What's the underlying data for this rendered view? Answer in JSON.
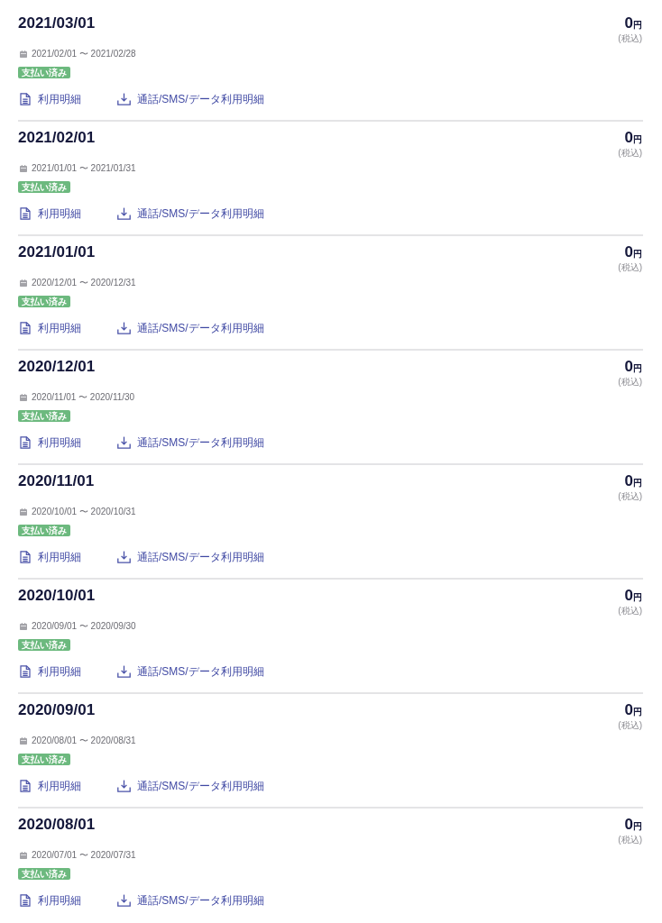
{
  "invoices": [
    {
      "billing_date": "2021/03/01",
      "amount": "0",
      "currency": "円",
      "tax_note": "(税込)",
      "period": "2021/02/01 〜 2021/02/28",
      "status": "支払い済み",
      "links": [
        {
          "kind": "statement",
          "label": "利用明細"
        },
        {
          "kind": "download",
          "label": "通話/SMS/データ利用明細"
        }
      ]
    },
    {
      "billing_date": "2021/02/01",
      "amount": "0",
      "currency": "円",
      "tax_note": "(税込)",
      "period": "2021/01/01 〜 2021/01/31",
      "status": "支払い済み",
      "links": [
        {
          "kind": "statement",
          "label": "利用明細"
        },
        {
          "kind": "download",
          "label": "通話/SMS/データ利用明細"
        }
      ]
    },
    {
      "billing_date": "2021/01/01",
      "amount": "0",
      "currency": "円",
      "tax_note": "(税込)",
      "period": "2020/12/01 〜 2020/12/31",
      "status": "支払い済み",
      "links": [
        {
          "kind": "statement",
          "label": "利用明細"
        },
        {
          "kind": "download",
          "label": "通話/SMS/データ利用明細"
        }
      ]
    },
    {
      "billing_date": "2020/12/01",
      "amount": "0",
      "currency": "円",
      "tax_note": "(税込)",
      "period": "2020/11/01 〜 2020/11/30",
      "status": "支払い済み",
      "links": [
        {
          "kind": "statement",
          "label": "利用明細"
        },
        {
          "kind": "download",
          "label": "通話/SMS/データ利用明細"
        }
      ]
    },
    {
      "billing_date": "2020/11/01",
      "amount": "0",
      "currency": "円",
      "tax_note": "(税込)",
      "period": "2020/10/01 〜 2020/10/31",
      "status": "支払い済み",
      "links": [
        {
          "kind": "statement",
          "label": "利用明細"
        },
        {
          "kind": "download",
          "label": "通話/SMS/データ利用明細"
        }
      ]
    },
    {
      "billing_date": "2020/10/01",
      "amount": "0",
      "currency": "円",
      "tax_note": "(税込)",
      "period": "2020/09/01 〜 2020/09/30",
      "status": "支払い済み",
      "links": [
        {
          "kind": "statement",
          "label": "利用明細"
        },
        {
          "kind": "download",
          "label": "通話/SMS/データ利用明細"
        }
      ]
    },
    {
      "billing_date": "2020/09/01",
      "amount": "0",
      "currency": "円",
      "tax_note": "(税込)",
      "period": "2020/08/01 〜 2020/08/31",
      "status": "支払い済み",
      "links": [
        {
          "kind": "statement",
          "label": "利用明細"
        },
        {
          "kind": "download",
          "label": "通話/SMS/データ利用明細"
        }
      ]
    },
    {
      "billing_date": "2020/08/01",
      "amount": "0",
      "currency": "円",
      "tax_note": "(税込)",
      "period": "2020/07/01 〜 2020/07/31",
      "status": "支払い済み",
      "links": [
        {
          "kind": "statement",
          "label": "利用明細"
        },
        {
          "kind": "download",
          "label": "通話/SMS/データ利用明細"
        }
      ]
    }
  ]
}
